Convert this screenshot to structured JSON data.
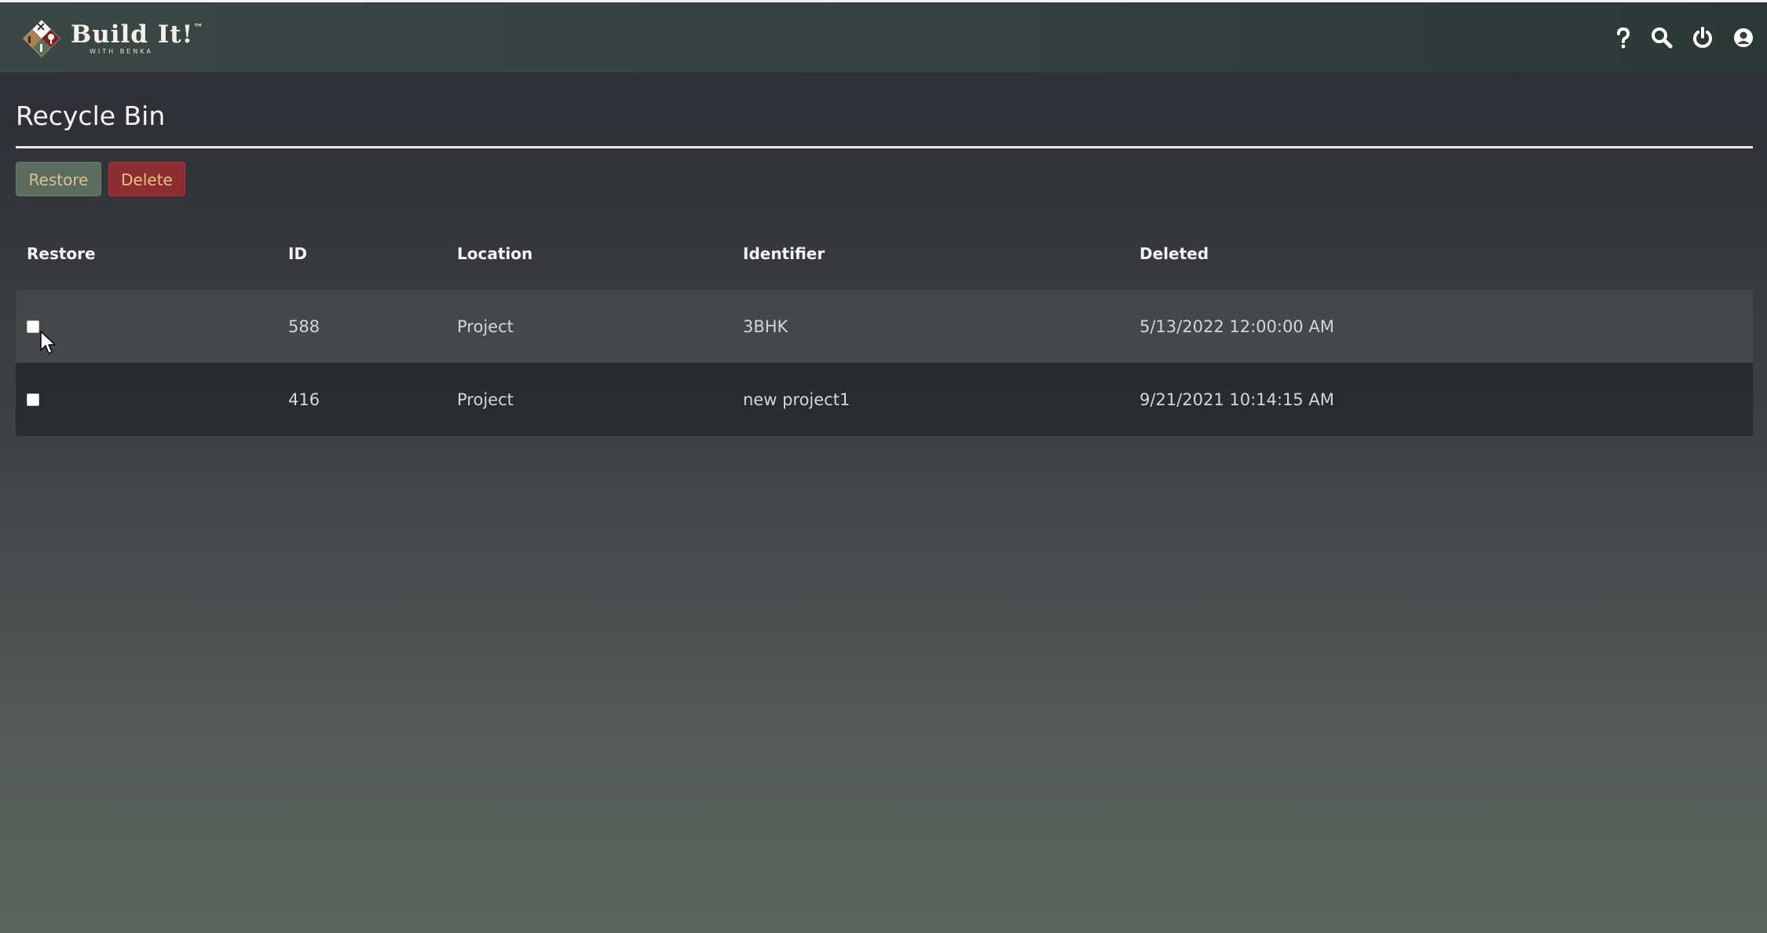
{
  "app": {
    "logo_title": "Build It!",
    "logo_trademark": "™",
    "logo_subtitle": "WITH BENKA"
  },
  "header_icons": [
    "help-icon",
    "search-icon",
    "power-icon",
    "user-icon"
  ],
  "page": {
    "title": "Recycle Bin"
  },
  "toolbar": {
    "restore_label": "Restore",
    "delete_label": "Delete"
  },
  "table": {
    "columns": [
      "Restore",
      "ID",
      "Location",
      "Identifier",
      "Deleted"
    ],
    "rows": [
      {
        "checked": false,
        "id": "588",
        "location": "Project",
        "identifier": "3BHK",
        "deleted": "5/13/2022 12:00:00 AM"
      },
      {
        "checked": false,
        "id": "416",
        "location": "Project",
        "identifier": "new project1",
        "deleted": "9/21/2021 10:14:15 AM"
      }
    ]
  },
  "colors": {
    "header_bg": "#34413f",
    "restore_button_bg": "#5b6b60",
    "restore_button_text": "#d9c48d",
    "delete_button_bg": "#8d2d31",
    "delete_button_text": "#e8c57e"
  }
}
